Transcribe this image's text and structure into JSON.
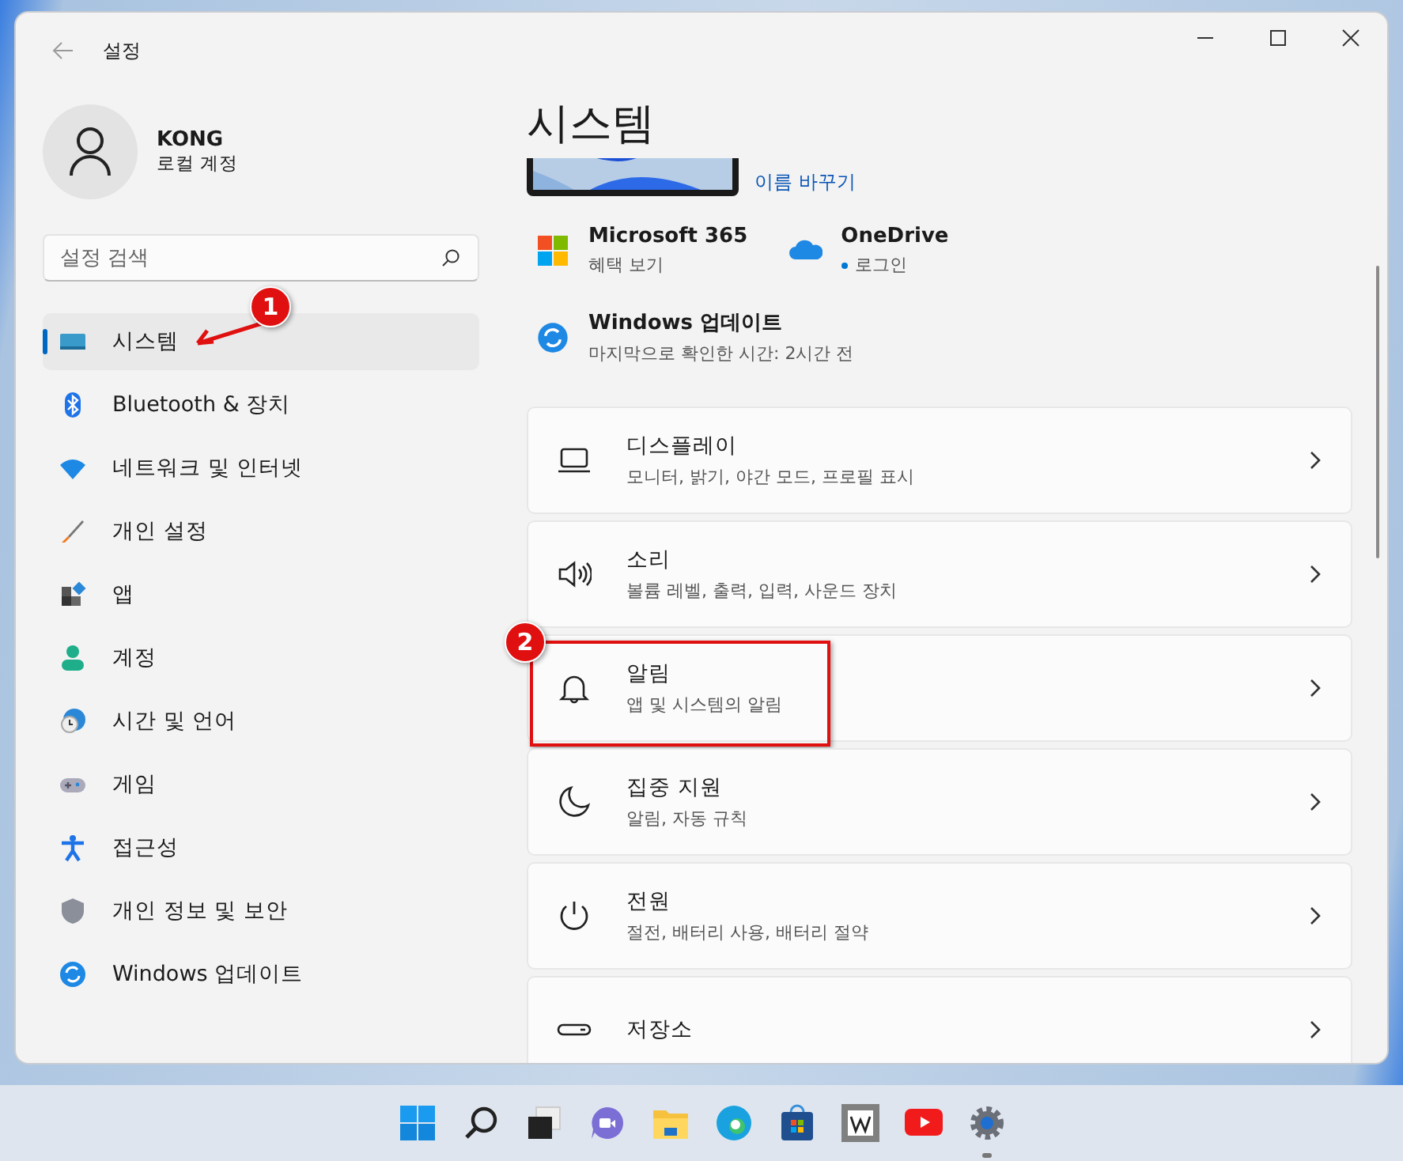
{
  "window": {
    "title": "설정"
  },
  "account": {
    "name": "KONG",
    "type": "로컬 계정"
  },
  "search": {
    "placeholder": "설정 검색"
  },
  "sidebar": {
    "items": [
      {
        "kind": "system",
        "label": "시스템",
        "selected": true,
        "callout": "1"
      },
      {
        "kind": "bluetooth",
        "label": "Bluetooth & 장치",
        "selected": false
      },
      {
        "kind": "network",
        "label": "네트워크 및 인터넷",
        "selected": false
      },
      {
        "kind": "personalize",
        "label": "개인 설정",
        "selected": false
      },
      {
        "kind": "apps",
        "label": "앱",
        "selected": false
      },
      {
        "kind": "accounts",
        "label": "계정",
        "selected": false
      },
      {
        "kind": "time",
        "label": "시간 및 언어",
        "selected": false
      },
      {
        "kind": "gaming",
        "label": "게임",
        "selected": false
      },
      {
        "kind": "accessibility",
        "label": "접근성",
        "selected": false
      },
      {
        "kind": "privacy",
        "label": "개인 정보 및 보안",
        "selected": false
      },
      {
        "kind": "update",
        "label": "Windows 업데이트",
        "selected": false
      }
    ]
  },
  "page": {
    "title": "시스템",
    "device": {
      "link": "이름 바꾸기"
    },
    "tiles": [
      {
        "kind": "microsoft365",
        "title": "Microsoft 365",
        "subtitle": "혜택 보기"
      },
      {
        "kind": "onedrive",
        "title": "OneDrive",
        "subtitle": "로그인",
        "signed_in": true
      }
    ],
    "update": {
      "title": "Windows 업데이트",
      "subtitle": "마지막으로 확인한 시간: 2시간 전"
    },
    "cards": [
      {
        "kind": "display",
        "title": "디스플레이",
        "subtitle": "모니터, 밝기, 야간 모드, 프로필 표시"
      },
      {
        "kind": "sound",
        "title": "소리",
        "subtitle": "볼륨 레벨, 출력, 입력, 사운드 장치"
      },
      {
        "kind": "notifications",
        "title": "알림",
        "subtitle": "앱 및 시스템의 알림",
        "callout": "2"
      },
      {
        "kind": "focus",
        "title": "집중 지원",
        "subtitle": "알림, 자동 규칙"
      },
      {
        "kind": "power",
        "title": "전원",
        "subtitle": "절전, 배터리 사용, 배터리 절약"
      },
      {
        "kind": "storage",
        "title": "저장소"
      }
    ]
  },
  "taskbar": {
    "items": [
      {
        "kind": "start"
      },
      {
        "kind": "search"
      },
      {
        "kind": "taskview"
      },
      {
        "kind": "chat"
      },
      {
        "kind": "explorer"
      },
      {
        "kind": "edge"
      },
      {
        "kind": "store"
      },
      {
        "kind": "wiki"
      },
      {
        "kind": "youtube"
      },
      {
        "kind": "settings",
        "active": true
      }
    ]
  }
}
